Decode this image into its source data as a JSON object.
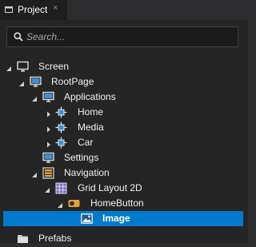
{
  "panel": {
    "tab_title": "Project",
    "tab_close_glyph": "×"
  },
  "search": {
    "placeholder": "Search..."
  },
  "tree": {
    "screen": {
      "label": "Screen",
      "icon": "screen-icon"
    },
    "root_page": {
      "label": "RootPage",
      "icon": "page-icon"
    },
    "applications": {
      "label": "Applications",
      "icon": "page-icon"
    },
    "home": {
      "label": "Home",
      "icon": "component-icon"
    },
    "media": {
      "label": "Media",
      "icon": "component-icon"
    },
    "car": {
      "label": "Car",
      "icon": "component-icon"
    },
    "settings": {
      "label": "Settings",
      "icon": "page-icon"
    },
    "navigation": {
      "label": "Navigation",
      "icon": "stack-layout-icon"
    },
    "grid_layout": {
      "label": "Grid Layout 2D",
      "icon": "grid-layout-icon"
    },
    "home_button": {
      "label": "HomeButton",
      "icon": "toggle-button-icon"
    },
    "image": {
      "label": "Image",
      "icon": "image-icon",
      "selected": true
    },
    "prefabs": {
      "label": "Prefabs",
      "icon": "folder-icon"
    }
  },
  "colors": {
    "background": "#252526",
    "selection": "#007acc",
    "text": "#f1f1f1"
  }
}
